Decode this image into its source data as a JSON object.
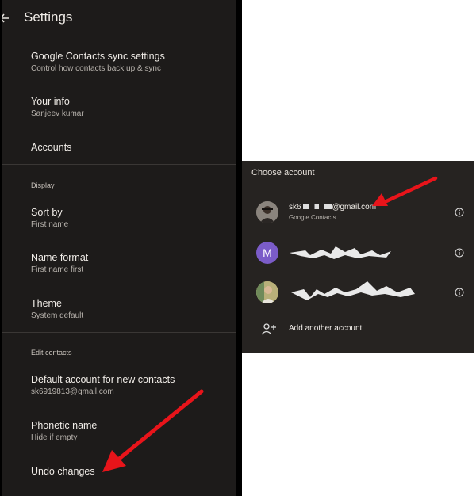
{
  "settings": {
    "title": "Settings",
    "sync": {
      "title": "Google Contacts sync settings",
      "subtitle": "Control how contacts back up & sync"
    },
    "your_info": {
      "title": "Your info",
      "subtitle": "Sanjeev kumar"
    },
    "accounts": {
      "title": "Accounts"
    },
    "display_section": "Display",
    "sort_by": {
      "title": "Sort by",
      "subtitle": "First name"
    },
    "name_format": {
      "title": "Name format",
      "subtitle": "First name first"
    },
    "theme": {
      "title": "Theme",
      "subtitle": "System default"
    },
    "edit_section": "Edit contacts",
    "default_account": {
      "title": "Default account for new contacts",
      "subtitle": "sk6919813@gmail.com"
    },
    "phonetic": {
      "title": "Phonetic name",
      "subtitle": "Hide if empty"
    },
    "undo": {
      "title": "Undo changes"
    }
  },
  "chooser": {
    "title": "Choose account",
    "accounts": [
      {
        "email_start": "sk6",
        "email_end": "@gmail.com",
        "subtitle": "Google Contacts"
      },
      {
        "avatar_letter": "M"
      }
    ],
    "add_label": "Add another account"
  },
  "colors": {
    "arrow": "#e8141a",
    "avatar_purple": "#7b5cc8",
    "panel": "#262321",
    "background": "#1d1b1a"
  },
  "icons": [
    "back-arrow-icon",
    "info-icon",
    "add-person-icon"
  ]
}
